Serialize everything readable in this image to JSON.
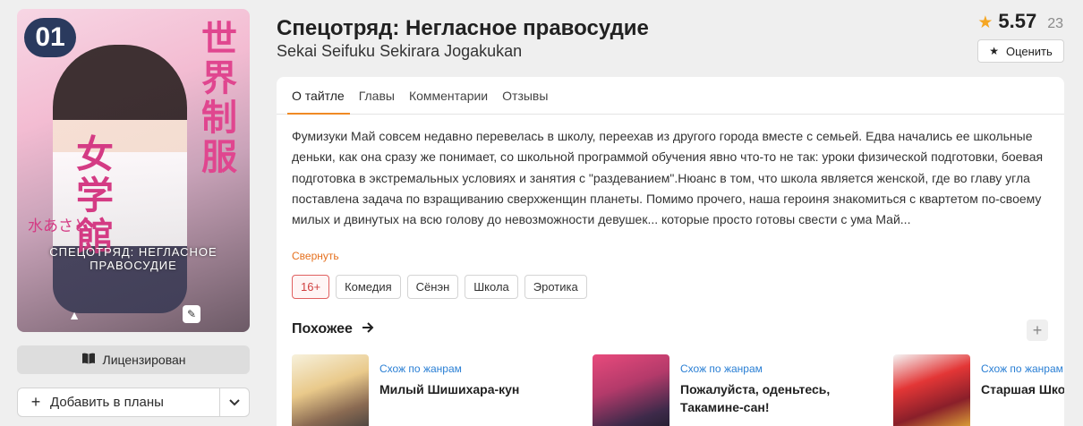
{
  "cover": {
    "volume": "01",
    "kanji_top": "世界制服",
    "kanji_main": "女学館",
    "author": "水あさと",
    "subtitle": "СПЕЦОТРЯД: НЕГЛАСНОЕ ПРАВОСУДИЕ"
  },
  "sidebar": {
    "licensed_label": "Лицензирован",
    "add_plans_label": "Добавить в планы"
  },
  "header": {
    "title": "Спецотряд: Негласное правосудие",
    "subtitle": "Sekai Seifuku Sekirara Jogakukan",
    "rating": "5.57",
    "votes": "23",
    "rate_label": "Оценить"
  },
  "tabs": [
    {
      "label": "О тайтле"
    },
    {
      "label": "Главы"
    },
    {
      "label": "Комментарии"
    },
    {
      "label": "Отзывы"
    }
  ],
  "description": "Фумизуки Май совсем недавно перевелась в школу, переехав из другого города вместе с семьей. Едва начались ее школьные деньки, как она сразу же понимает, со школьной программой обучения явно что-то не так: уроки физической подготовки, боевая подготовка в экстремальных условиях и занятия с \"раздеванием\".Нюанс в том, что школа является женской, где во главу угла поставлена задача по взращиванию сверхженщин планеты. Помимо прочего, наша героиня знакомиться с квартетом по-своему милых и двинутых на всю голову до невозможности девушек... которые просто готовы свести с ума Май...",
  "collapse_label": "Свернуть",
  "tags": [
    "16+",
    "Комедия",
    "Сёнэн",
    "Школа",
    "Эротика"
  ],
  "similar": {
    "heading": "Похожее",
    "items": [
      {
        "kind": "Схож по жанрам",
        "name": "Милый Шишихара-кун"
      },
      {
        "kind": "Схож по жанрам",
        "name": "Пожалуйста, оденьтесь, Такамине-сан!"
      },
      {
        "kind": "Схож по жанрам",
        "name": "Старшая Шко"
      }
    ]
  },
  "colors": {
    "accent": "#f08a24",
    "link": "#2a7fd4",
    "star": "#f5a623"
  }
}
